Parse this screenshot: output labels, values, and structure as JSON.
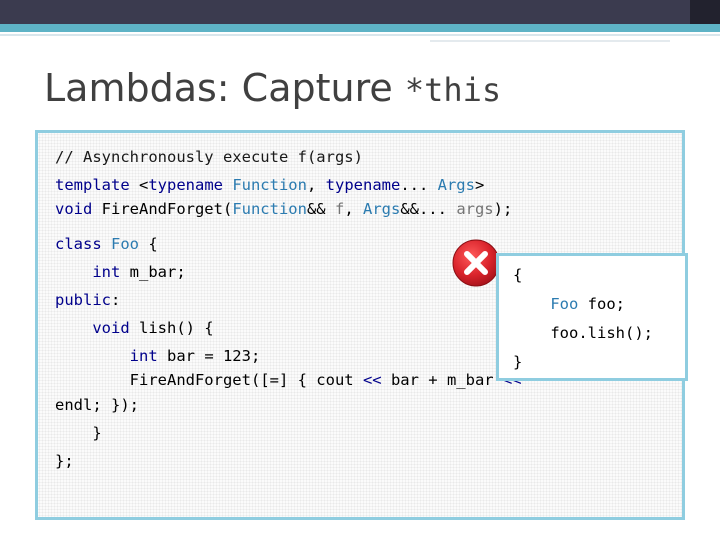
{
  "slide": {
    "title_text": "Lambdas: Capture ",
    "title_code": "*this",
    "accent_color": "#5eb3c6",
    "border_color": "#8fcde0",
    "keyword_color": "#00008b",
    "type_color": "#2b7bb0"
  },
  "code": {
    "comment": "// Asynchronously execute f(args)",
    "l2_template": "template",
    "l2_lt": " <",
    "l2_typename1": "typename",
    "l2_function": " Function",
    "l2_comma1": ", ",
    "l2_typename2": "typename",
    "l2_ellipsis": "...",
    "l2_args": " Args",
    "l2_gt": ">",
    "l3_void": "void",
    "l3_fname": " FireAndForget(",
    "l3_function": "Function",
    "l3_ref1": "&&",
    "l3_f": " f",
    "l3_comma": ", ",
    "l3_args": "Args",
    "l3_ref2": "&&...",
    "l3_argsparam": " args",
    "l3_end": ");",
    "l4_class": "class",
    "l4_foo": " Foo",
    "l4_brace": " {",
    "l5_indent": "    ",
    "l5_int": "int",
    "l5_rest": " m_bar;",
    "l6_public": "public",
    "l6_colon": ":",
    "l7_indent": "    ",
    "l7_void": "void",
    "l7_rest": " lish() {",
    "l8_indent": "        ",
    "l8_int": "int",
    "l8_rest": " bar = 123;",
    "l9_text": "        FireAndForget([=] { cout ",
    "l9_op1": "<<",
    "l9_mid": " bar + m_bar ",
    "l9_op2": "<<",
    "l10_text": "endl; });",
    "l11_text": "    }",
    "l12_text": "};"
  },
  "popup": {
    "l1": "{",
    "l2_indent": "    ",
    "l2_foo": "Foo",
    "l2_rest": " foo;",
    "l3": "    foo.lish();",
    "l4": "}"
  },
  "icons": {
    "error": "error-x-icon",
    "error_color": "#d9232b"
  }
}
